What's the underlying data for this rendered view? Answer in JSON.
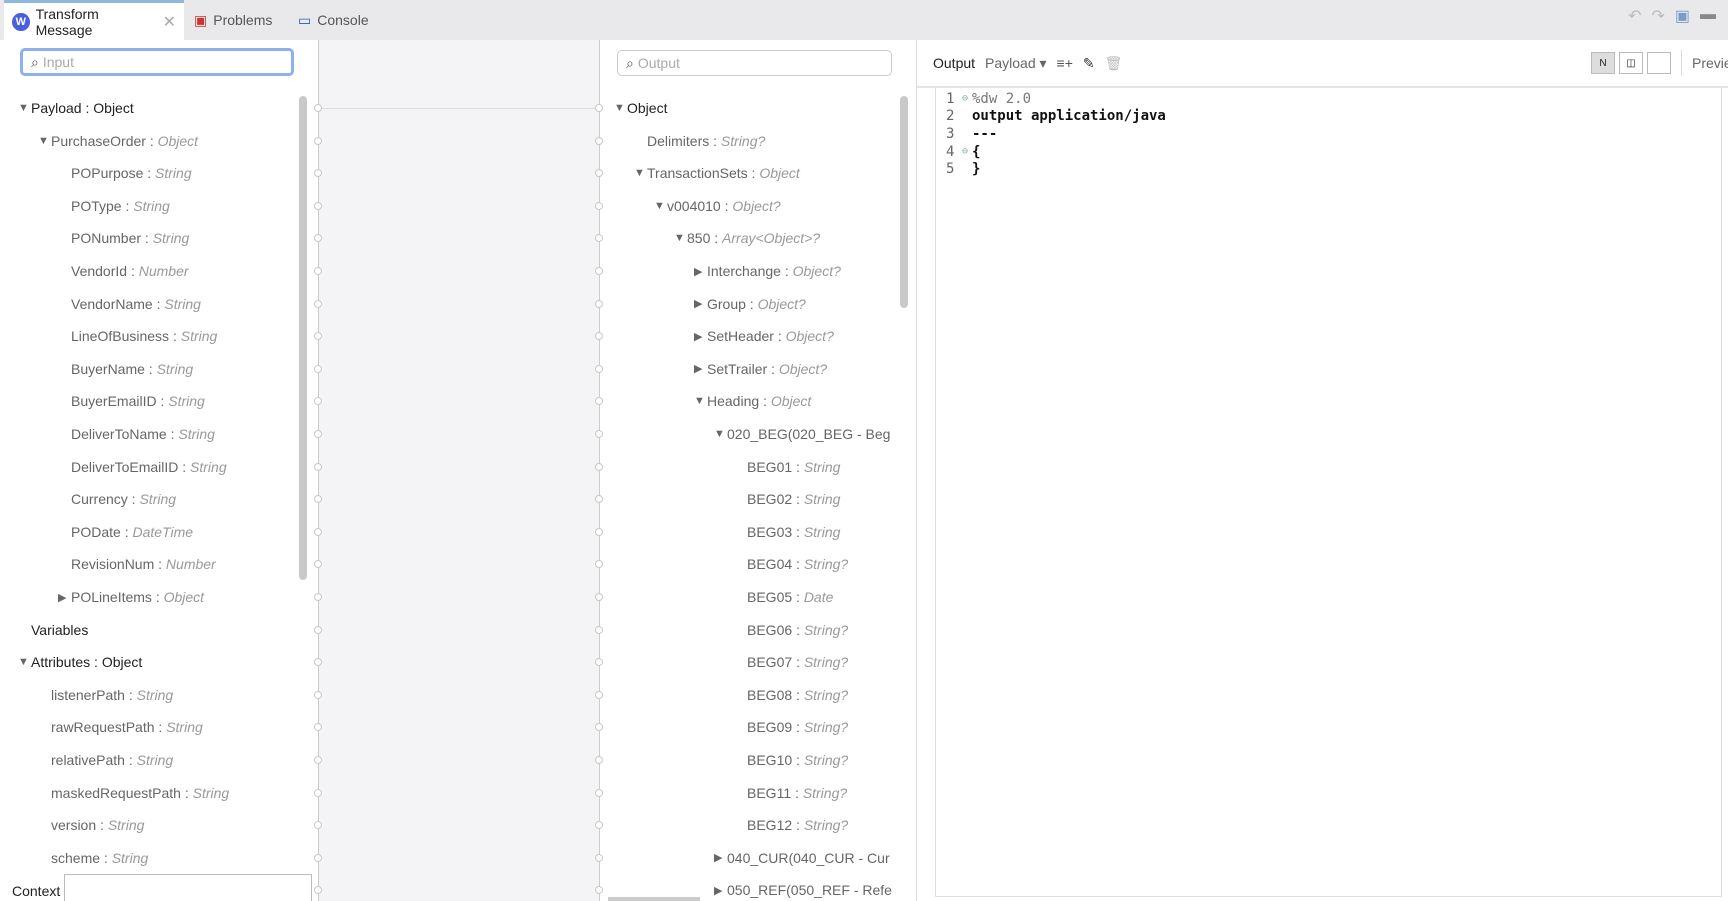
{
  "tabs": [
    {
      "label": "Transform Message",
      "active": true
    },
    {
      "label": "Problems"
    },
    {
      "label": "Console"
    }
  ],
  "input_search": {
    "placeholder": "Input"
  },
  "output_search": {
    "placeholder": "Output"
  },
  "input_tree": [
    {
      "depth": 0,
      "name": "Payload",
      "type": "Object",
      "expanded": true,
      "top": true
    },
    {
      "depth": 1,
      "name": "PurchaseOrder",
      "type": "Object",
      "expanded": true
    },
    {
      "depth": 2,
      "name": "POPurpose",
      "type": "String"
    },
    {
      "depth": 2,
      "name": "POType",
      "type": "String"
    },
    {
      "depth": 2,
      "name": "PONumber",
      "type": "String"
    },
    {
      "depth": 2,
      "name": "VendorId",
      "type": "Number"
    },
    {
      "depth": 2,
      "name": "VendorName",
      "type": "String"
    },
    {
      "depth": 2,
      "name": "LineOfBusiness",
      "type": "String"
    },
    {
      "depth": 2,
      "name": "BuyerName",
      "type": "String"
    },
    {
      "depth": 2,
      "name": "BuyerEmailID",
      "type": "String"
    },
    {
      "depth": 2,
      "name": "DeliverToName",
      "type": "String"
    },
    {
      "depth": 2,
      "name": "DeliverToEmailID",
      "type": "String"
    },
    {
      "depth": 2,
      "name": "Currency",
      "type": "String"
    },
    {
      "depth": 2,
      "name": "PODate",
      "type": "DateTime"
    },
    {
      "depth": 2,
      "name": "RevisionNum",
      "type": "Number"
    },
    {
      "depth": 2,
      "name": "POLineItems",
      "type": "Object",
      "expanded": false
    },
    {
      "depth": 0,
      "name": "Variables",
      "type": "",
      "top": true
    },
    {
      "depth": 0,
      "name": "Attributes",
      "type": "Object",
      "expanded": true,
      "top": true
    },
    {
      "depth": 1,
      "name": "listenerPath",
      "type": "String"
    },
    {
      "depth": 1,
      "name": "rawRequestPath",
      "type": "String"
    },
    {
      "depth": 1,
      "name": "relativePath",
      "type": "String"
    },
    {
      "depth": 1,
      "name": "maskedRequestPath",
      "type": "String"
    },
    {
      "depth": 1,
      "name": "version",
      "type": "String"
    },
    {
      "depth": 1,
      "name": "scheme",
      "type": "String"
    }
  ],
  "output_tree": [
    {
      "depth": 0,
      "name": "Object",
      "type": "",
      "expanded": true,
      "top": true
    },
    {
      "depth": 1,
      "name": "Delimiters",
      "type": "String?"
    },
    {
      "depth": 1,
      "name": "TransactionSets",
      "type": "Object",
      "expanded": true
    },
    {
      "depth": 2,
      "name": "v004010",
      "type": "Object?",
      "expanded": true
    },
    {
      "depth": 3,
      "name": "850",
      "type": "Array<Object>?",
      "expanded": true
    },
    {
      "depth": 4,
      "name": "Interchange",
      "type": "Object?",
      "expanded": false
    },
    {
      "depth": 4,
      "name": "Group",
      "type": "Object?",
      "expanded": false
    },
    {
      "depth": 4,
      "name": "SetHeader",
      "type": "Object?",
      "expanded": false
    },
    {
      "depth": 4,
      "name": "SetTrailer",
      "type": "Object?",
      "expanded": false
    },
    {
      "depth": 4,
      "name": "Heading",
      "type": "Object",
      "expanded": true
    },
    {
      "depth": 5,
      "name": "020_BEG(020_BEG - Beg",
      "type": "",
      "expanded": true,
      "raw": true
    },
    {
      "depth": 6,
      "name": "BEG01",
      "type": "String"
    },
    {
      "depth": 6,
      "name": "BEG02",
      "type": "String"
    },
    {
      "depth": 6,
      "name": "BEG03",
      "type": "String"
    },
    {
      "depth": 6,
      "name": "BEG04",
      "type": "String?"
    },
    {
      "depth": 6,
      "name": "BEG05",
      "type": "Date"
    },
    {
      "depth": 6,
      "name": "BEG06",
      "type": "String?"
    },
    {
      "depth": 6,
      "name": "BEG07",
      "type": "String?"
    },
    {
      "depth": 6,
      "name": "BEG08",
      "type": "String?"
    },
    {
      "depth": 6,
      "name": "BEG09",
      "type": "String?"
    },
    {
      "depth": 6,
      "name": "BEG10",
      "type": "String?"
    },
    {
      "depth": 6,
      "name": "BEG11",
      "type": "String?"
    },
    {
      "depth": 6,
      "name": "BEG12",
      "type": "String?"
    },
    {
      "depth": 5,
      "name": "040_CUR(040_CUR - Cur",
      "type": "",
      "expanded": false,
      "raw": true
    },
    {
      "depth": 5,
      "name": "050_REF(050_REF - Refe",
      "type": "",
      "expanded": false,
      "raw": true
    }
  ],
  "context": {
    "label": "Context",
    "value": ""
  },
  "editor": {
    "output_label": "Output",
    "payload_label": "Payload",
    "preview_label": "Preview",
    "lines": [
      {
        "n": "1",
        "fold": true,
        "text": "%dw 2.0",
        "bold": false
      },
      {
        "n": "2",
        "fold": false,
        "text": "output application/java",
        "bold": true
      },
      {
        "n": "3",
        "fold": false,
        "text": "---",
        "bold": true
      },
      {
        "n": "4",
        "fold": true,
        "text": "{",
        "bold": true
      },
      {
        "n": "5",
        "fold": false,
        "text": "}",
        "bold": true
      }
    ]
  }
}
